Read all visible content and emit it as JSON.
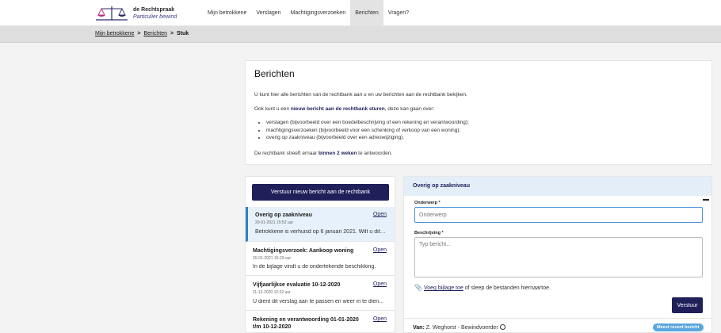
{
  "brand": {
    "title": "de Rechtspraak",
    "subtitle": "Particulier bewind"
  },
  "nav": [
    {
      "label": "Mijn betrokkene"
    },
    {
      "label": "Verslagen"
    },
    {
      "label": "Machtigingsverzoeken"
    },
    {
      "label": "Berichten",
      "active": true
    },
    {
      "label": "Vragen?"
    }
  ],
  "breadcrumb": {
    "item1": "Mijn betrokkene",
    "sep": ">",
    "item2": "Berichten",
    "current": "Stuk"
  },
  "info": {
    "title": "Berichten",
    "intro": "U kunt hier alle berichten van de rechtbank aan u en uw berichten aan de rechtbank bekijken.",
    "p2_pre": "Ook kunt u een ",
    "p2_bold": "nieuw bericht aan de rechtbank sturen",
    "p2_post": ", deze kan gaan over:",
    "bullets": [
      "verslagen (bijvoorbeeld over een boedelbeschrijving of een rekening en verantwoording);",
      "machtigingsverzoeken (bijvoorbeeld voor een schenking of verkoop van een woning);",
      "overig op zaakniveau (bijvoorbeeld over een adreswijziging)."
    ],
    "p3_pre": "De rechtbank streeft ernaar ",
    "p3_bold": "binnen 2 weken",
    "p3_post": " te antwoorden."
  },
  "list": {
    "send_button": "Verstuur nieuw bericht aan de rechtbank",
    "open_label": "Open",
    "messages": [
      {
        "title": "Overig op zaakniveau",
        "date": "20-01-2021 15:52 uur",
        "text": "Betrokkene is verhuisd op 6 januari 2021. Wilt u dit ..."
      },
      {
        "title": "Machtigingsverzoek: Aankoop woning",
        "date": "20-01-2021 15:29 uur",
        "text": "In de bijlage vindt u de ondertekende beschikking."
      },
      {
        "title": "Vijfjaarlijkse evaluatie 10-12-2020",
        "date": "11-12-2020 12:32 uur",
        "text": "U dient dit verslag aan te passen en weer in te dien..."
      },
      {
        "title": "Rekening en verantwoording 01-01-2020 t/m 10-12-2020",
        "date": "",
        "text": ""
      }
    ]
  },
  "form": {
    "header": "Overig op zaakniveau",
    "subject_label": "Onderwerp *",
    "subject_placeholder": "Onderwerp",
    "desc_label": "Beschrijving *",
    "desc_placeholder": "Typ bericht...",
    "attach_link": "Voeg bijlage toe",
    "attach_rest": " of sleep de bestanden hiernaartoe.",
    "submit": "Verstuur"
  },
  "sender": {
    "label": "Van:",
    "name": " Z. Weghorst - Bewindvoerder",
    "badge": "Meest recent bericht"
  },
  "colors": {
    "primary": "#1f1f5a",
    "accent": "#2f7fc1",
    "badge": "#5aa6de"
  }
}
